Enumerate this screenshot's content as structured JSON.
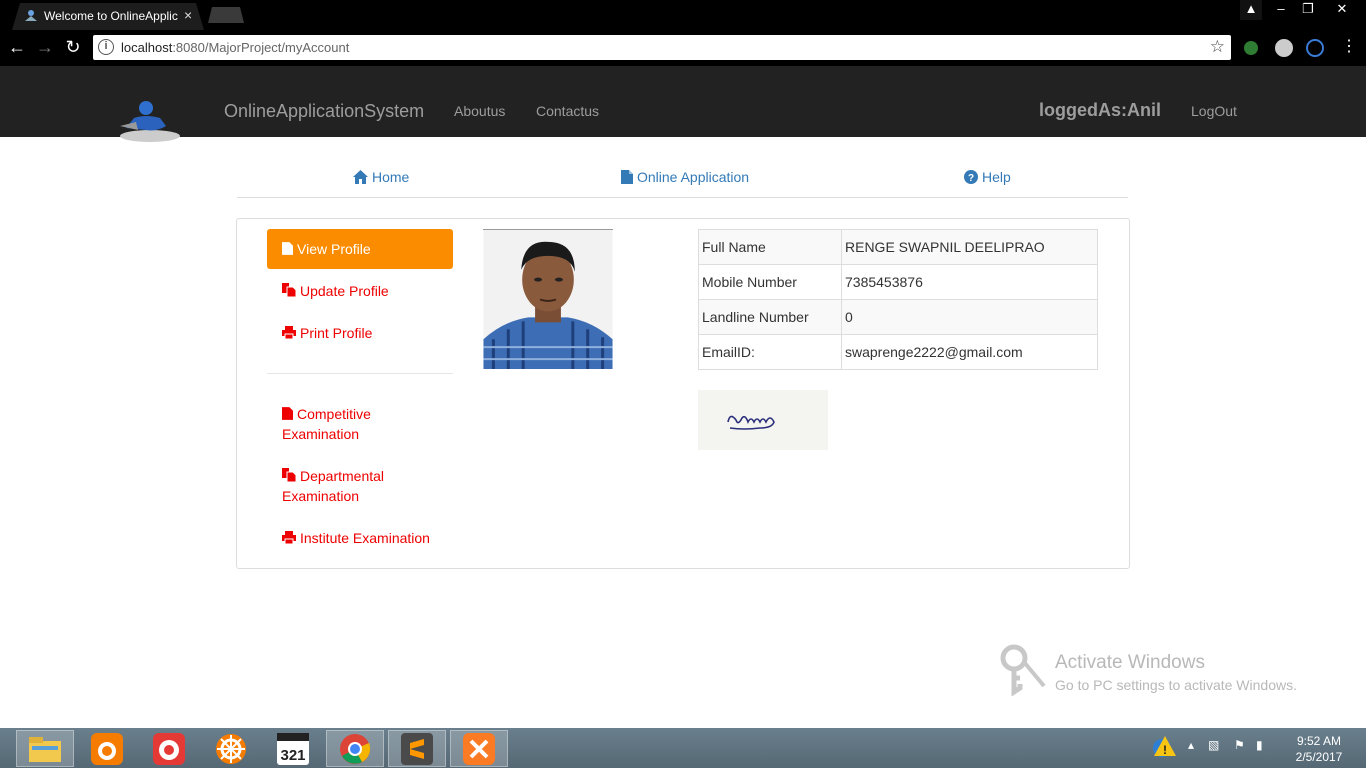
{
  "browser": {
    "tab_title": "Welcome to OnlineApplic",
    "tab_close": "×",
    "url_host": "localhost",
    "url_path": ":8080/MajorProject/myAccount",
    "win_controls": [
      "▲",
      "–",
      "❐",
      "✕"
    ]
  },
  "appnav": {
    "brand": "OnlineApplicationSystem",
    "links": [
      "Aboutus",
      "Contactus"
    ],
    "logged_as": "loggedAs:Anil",
    "logout": "LogOut"
  },
  "subnav": {
    "home": "Home",
    "online_application": "Online Application",
    "help": "Help"
  },
  "sidebar": {
    "view_profile": "View Profile",
    "update_profile": "Update Profile",
    "print_profile": "Print Profile",
    "competitive_1": "Competitive",
    "competitive_2": "Examination",
    "departmental_1": "Departmental",
    "departmental_2": "Examination",
    "institute": "Institute Examination"
  },
  "profile": {
    "rows": [
      {
        "label": "Full Name",
        "value": "RENGE SWAPNIL DEELIPRAO"
      },
      {
        "label": "Mobile Number",
        "value": "7385453876"
      },
      {
        "label": "Landline Number",
        "value": "0"
      },
      {
        "label": "EmailID:",
        "value": "swaprenge2222@gmail.com"
      }
    ]
  },
  "watermark": {
    "title": "Activate Windows",
    "subtitle": "Go to PC settings to activate Windows."
  },
  "taskbar": {
    "time": "9:52 AM",
    "date": "2/5/2017"
  },
  "colors": {
    "accent_orange": "#fb8c00",
    "link_blue": "#337ab7",
    "link_red": "#ee0000",
    "navbar": "#222222"
  }
}
